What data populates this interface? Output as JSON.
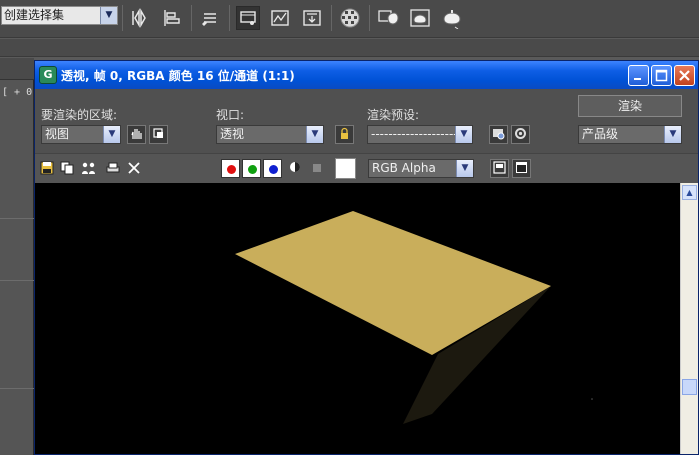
{
  "toolbar": {
    "selection_set": "创建选择集",
    "icons": [
      "mirror-icon",
      "align-icon",
      "layer-manager-icon",
      "graph-editor-icon",
      "curve-editor-icon",
      "schematic-view-icon",
      "material-editor-icon",
      "render-setup-icon",
      "rendered-frame-icon",
      "render-production-icon",
      "render-iterative-icon"
    ]
  },
  "left_viewport": {
    "label": "[ + 0"
  },
  "window": {
    "title": "透视, 帧 0, RGBA 颜色 16 位/通道 (1:1)",
    "icon_letter": "G",
    "controls": [
      "minimize",
      "maximize",
      "close"
    ]
  },
  "render_panel": {
    "area_label": "要渲染的区域:",
    "area_value": "视图",
    "viewport_label": "视口:",
    "viewport_value": "透视",
    "preset_label": "渲染预设:",
    "preset_value": "--------------------",
    "render_button": "渲染",
    "render_mode": "产品级",
    "channel_value": "RGB Alpha"
  },
  "channels": {
    "red": "#e01010",
    "green": "#10a010",
    "blue": "#1020d0"
  },
  "scene": {
    "background": "#000000",
    "plane_color": "#c9ae5b",
    "shadow_color": "#1c190f"
  }
}
